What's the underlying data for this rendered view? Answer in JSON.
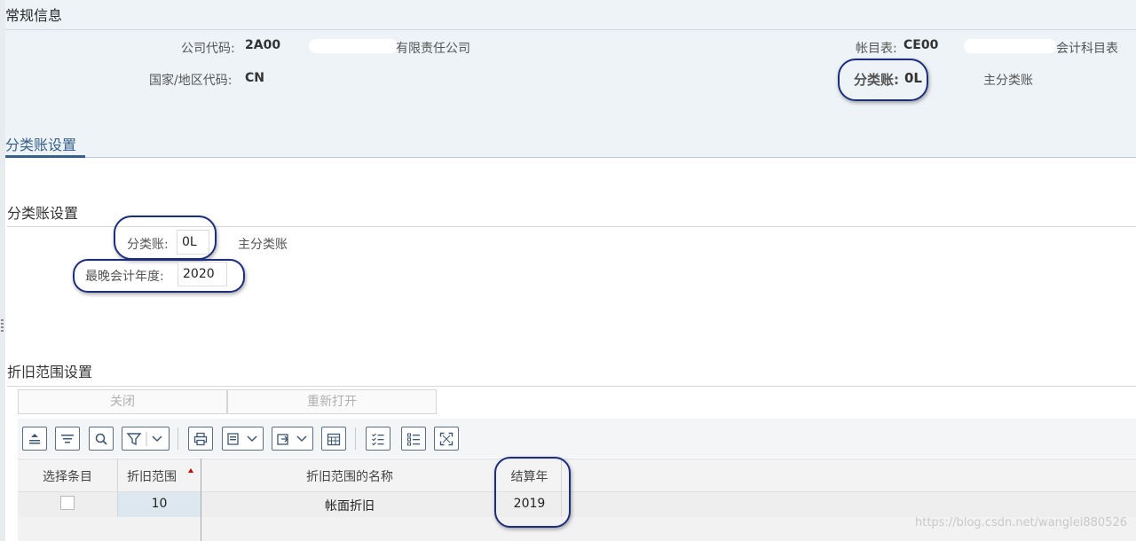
{
  "header": {
    "title": "常规信息",
    "company_code_label": "公司代码:",
    "company_code_value": "2A00",
    "company_name_suffix": "有限责任公司",
    "country_label": "国家/地区代码:",
    "country_value": "CN",
    "chart_of_accounts_label": "帐目表:",
    "chart_of_accounts_value": "CE00",
    "chart_of_accounts_suffix": "会计科目表",
    "ledger_label": "分类账:",
    "ledger_value": "0L",
    "ledger_desc": "主分类账"
  },
  "tabs": [
    {
      "label": "分类账设置"
    }
  ],
  "ledger_settings": {
    "section_title": "分类账设置",
    "ledger_label": "分类账:",
    "ledger_value": "0L",
    "ledger_desc": "主分类账",
    "fiscal_year_label": "最晚会计年度:",
    "fiscal_year_value": "2020"
  },
  "depreciation": {
    "section_title": "折旧范围设置",
    "close_button": "关闭",
    "reopen_button": "重新打开",
    "toolbar_icons": [
      "collapse-all-icon",
      "expand-list-icon",
      "search-icon",
      "filter-icon",
      "print-icon",
      "view-icon",
      "export-icon",
      "calendar-grid-icon",
      "checklist-icon",
      "list-icon",
      "fullscreen-icon"
    ],
    "columns": [
      "选择条目",
      "折旧范围",
      "折旧范围的名称",
      "结算年"
    ],
    "rows": [
      {
        "area": "10",
        "name": "帐面折旧",
        "year": "2019"
      }
    ]
  },
  "watermark": "https://blog.csdn.net/wanglei880526",
  "colors": {
    "header_bg": "#eef3f7",
    "accent": "#34608c",
    "callout": "#1c2e7c"
  }
}
